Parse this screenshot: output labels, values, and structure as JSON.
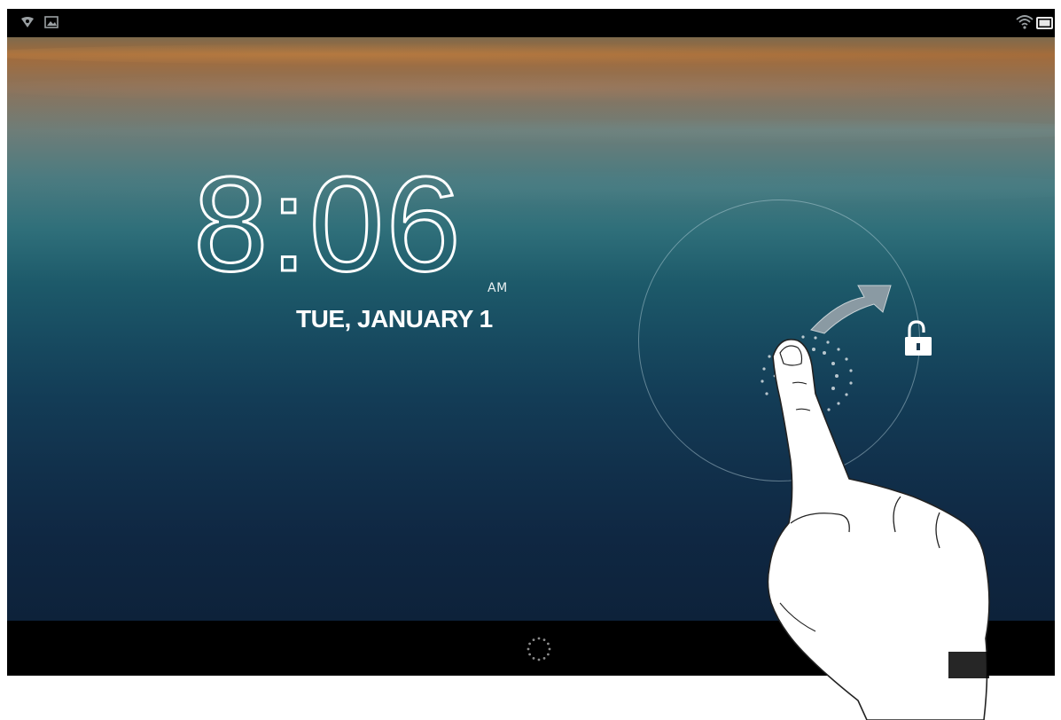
{
  "lock_screen": {
    "clock": {
      "time": "8:06",
      "ampm": "AM"
    },
    "date": "TUE, JANUARY 1",
    "unlock_target_icon": "unlock-padlock-icon",
    "gesture_arrow_icon": "curved-arrow-icon",
    "finger_illustration_icon": "pointing-hand-icon"
  },
  "status_bar": {
    "left_icons": [
      "notification-icon",
      "picture-icon"
    ],
    "right_icons": [
      "wifi-icon",
      "battery-icon"
    ]
  },
  "nav_bar": {
    "center_icon": "loading-spinner-icon"
  },
  "colors": {
    "text": "#ffffff",
    "bars": "#000000",
    "ring": "#bfd7e1"
  }
}
